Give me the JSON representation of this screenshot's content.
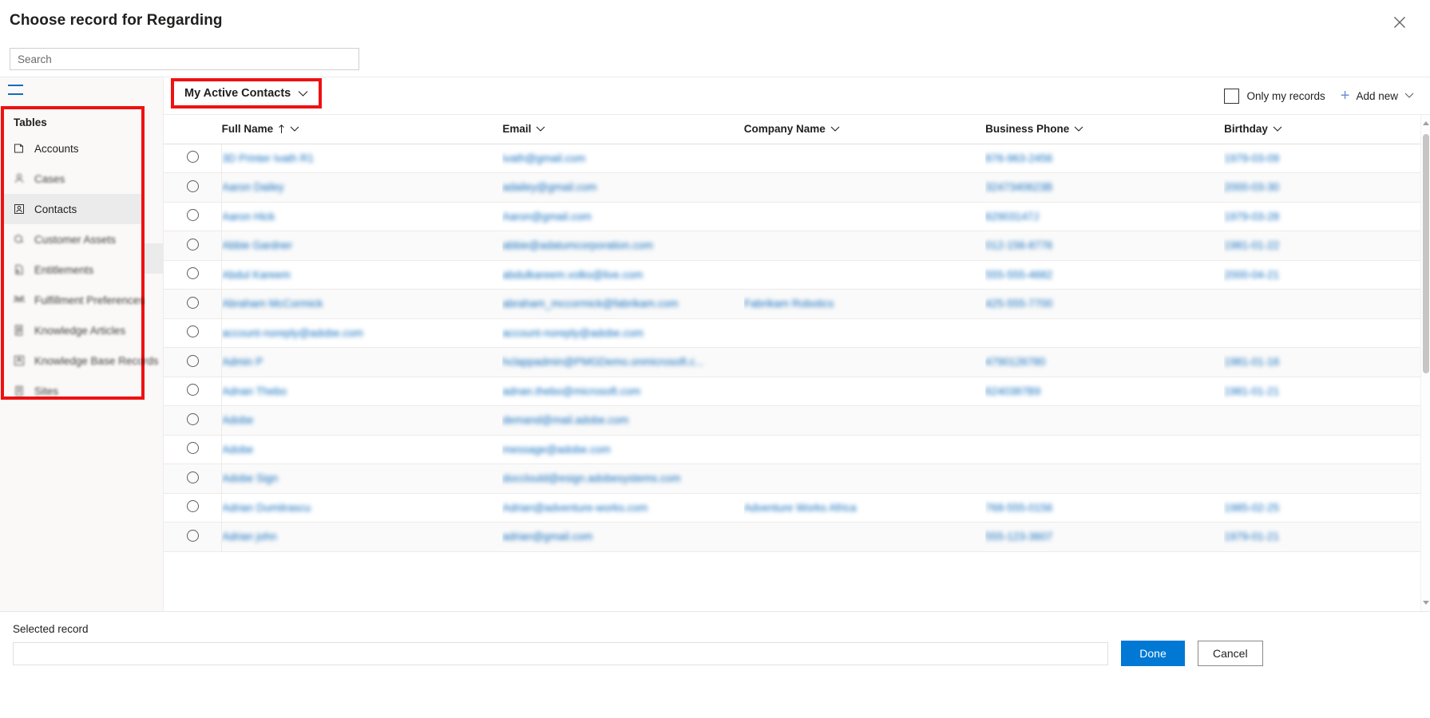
{
  "dialog": {
    "title": "Choose record for Regarding",
    "close_icon": "close-icon"
  },
  "search": {
    "placeholder": "Search",
    "value": ""
  },
  "sidebar": {
    "menu_icon": "hamburger-menu-icon",
    "heading": "Tables",
    "items": [
      {
        "label": "Accounts",
        "icon": "account-icon",
        "selected": false,
        "blurred": false
      },
      {
        "label": "Cases",
        "icon": "case-person-icon",
        "selected": false,
        "blurred": true
      },
      {
        "label": "Contacts",
        "icon": "contact-icon",
        "selected": true,
        "blurred": false
      },
      {
        "label": "Customer Assets",
        "icon": "box-asset-icon",
        "selected": false,
        "blurred": true
      },
      {
        "label": "Entitlements",
        "icon": "entitlement-document-icon",
        "selected": false,
        "blurred": true
      },
      {
        "label": "Fulfillment Preferences",
        "icon": "people-group-icon",
        "selected": false,
        "blurred": true
      },
      {
        "label": "Knowledge Articles",
        "icon": "article-document-icon",
        "selected": false,
        "blurred": true
      },
      {
        "label": "Knowledge Base Records",
        "icon": "knowledge-base-icon",
        "selected": false,
        "blurred": true
      },
      {
        "label": "Sites",
        "icon": "site-icon",
        "selected": false,
        "blurred": true
      }
    ]
  },
  "commandbar": {
    "view_selector": {
      "label": "My Active Contacts",
      "chevron_icon": "chevron-down-icon"
    },
    "only_my_records": {
      "label": "Only my records",
      "checked": false,
      "checkbox_icon": "checkbox-unchecked-icon"
    },
    "add_new": {
      "label": "Add new",
      "plus_icon": "plus-icon",
      "chevron_icon": "chevron-down-icon"
    }
  },
  "grid": {
    "columns": [
      {
        "key": "select",
        "label": "",
        "sorted": false
      },
      {
        "key": "fullname",
        "label": "Full Name",
        "sorted": true,
        "sort_icon": "sort-ascending-icon",
        "chevron_icon": "chevron-down-icon"
      },
      {
        "key": "email",
        "label": "Email",
        "sorted": false,
        "chevron_icon": "chevron-down-icon"
      },
      {
        "key": "company",
        "label": "Company Name",
        "sorted": false,
        "chevron_icon": "chevron-down-icon"
      },
      {
        "key": "phone",
        "label": "Business Phone",
        "sorted": false,
        "chevron_icon": "chevron-down-icon"
      },
      {
        "key": "birthday",
        "label": "Birthday",
        "sorted": false,
        "chevron_icon": "chevron-down-icon"
      }
    ],
    "rows": [
      {
        "fullname": "3D Printer Ivath R1",
        "email": "ivath@gmail.com",
        "company": "",
        "phone": "876-963-2456",
        "birthday": "1979-03-09"
      },
      {
        "fullname": "Aaron Dailey",
        "email": "adailey@gmail.com",
        "company": "",
        "phone": "3247340623B",
        "birthday": "2000-03-30"
      },
      {
        "fullname": "Aaron Hick",
        "email": "Aaron@gmail.com",
        "company": "",
        "phone": "62903147J",
        "birthday": "1979-03-28"
      },
      {
        "fullname": "Abbie Gardner",
        "email": "abbie@adatumcorporation.com",
        "company": "",
        "phone": "012-156-8776",
        "birthday": "1981-01-22"
      },
      {
        "fullname": "Abdul Kareem",
        "email": "abdulkareem.volks@live.com",
        "company": "",
        "phone": "555-555-4682",
        "birthday": "2000-04-21"
      },
      {
        "fullname": "Abraham McCormick",
        "email": "abraham_mccormick@fabrikam.com",
        "company": "Fabrikam Robotics",
        "phone": "425-555-7700",
        "birthday": ""
      },
      {
        "fullname": "account-noreply@adobe.com",
        "email": "account-noreply@adobe.com",
        "company": "",
        "phone": "",
        "birthday": ""
      },
      {
        "fullname": "Admin P",
        "email": "hclappadmin@PMGDemo.onmicrosoft.c...",
        "company": "",
        "phone": "4790126780",
        "birthday": "1981-01-16"
      },
      {
        "fullname": "Adnan Thebo",
        "email": "adnan.thebo@microsoft.com",
        "company": "",
        "phone": "6240387B9",
        "birthday": "1981-01-21"
      },
      {
        "fullname": "Adobe",
        "email": "demand@mail.adobe.com",
        "company": "",
        "phone": "",
        "birthday": ""
      },
      {
        "fullname": "Adobe",
        "email": "message@adobe.com",
        "company": "",
        "phone": "",
        "birthday": ""
      },
      {
        "fullname": "Adobe Sign",
        "email": "docclould@esign.adobesystems.com",
        "company": "",
        "phone": "",
        "birthday": ""
      },
      {
        "fullname": "Adrian Dumitrascu",
        "email": "Adrian@adventure-works.com",
        "company": "Adventure Works Africa",
        "phone": "768-555-0156",
        "birthday": "1985-02-25"
      },
      {
        "fullname": "Adrian john",
        "email": "adrian@gmail.com",
        "company": "",
        "phone": "555-123-3607",
        "birthday": "1979-01-21"
      }
    ]
  },
  "footer": {
    "selected_record_label": "Selected record",
    "selected_record_value": "",
    "done_label": "Done",
    "cancel_label": "Cancel"
  },
  "colors": {
    "accent": "#0078d4",
    "link": "#0f6cbd",
    "highlight_box": "#ee1111",
    "sidebar_bg": "#faf9f8"
  }
}
